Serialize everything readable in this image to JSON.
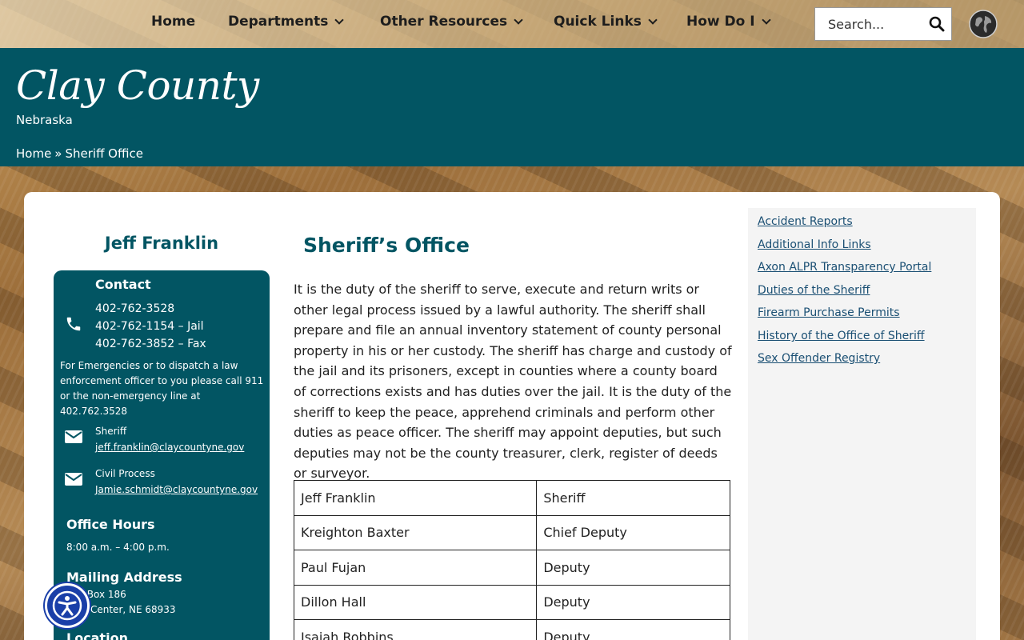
{
  "nav": {
    "items": [
      {
        "label": "Home",
        "dropdown": false
      },
      {
        "label": "Departments",
        "dropdown": true
      },
      {
        "label": "Other Resources",
        "dropdown": true
      },
      {
        "label": "Quick Links",
        "dropdown": true
      },
      {
        "label": "How Do I",
        "dropdown": true
      }
    ],
    "search_placeholder": "Search..."
  },
  "header": {
    "title": "Clay County",
    "subtitle": "Nebraska",
    "breadcrumb": {
      "home": "Home",
      "separator": "»",
      "current": "Sheriff Office"
    }
  },
  "contact": {
    "person_name": "Jeff Franklin",
    "heading": "Contact",
    "phones": [
      "402-762-3528",
      "402-762-1154 – Jail",
      "402-762-3852 – Fax"
    ],
    "emergency_note": "For Emergencies or to dispatch a law enforcement officer to you please call 911 or the non-emergency line at 402.762.3528",
    "emails": [
      {
        "label": "Sheriff",
        "address": "jeff.franklin@claycountyne.gov"
      },
      {
        "label": "Civil Process",
        "address": "Jamie.schmidt@claycountyne.gov"
      }
    ],
    "office_hours_heading": "Office Hours",
    "office_hours": "8:00 a.m. – 4:00 p.m.",
    "mailing_heading": "Mailing Address",
    "mailing_line1": "P.O. Box 186",
    "mailing_line2": "Clay Center, NE 68933",
    "location_heading": "Location"
  },
  "main": {
    "title": "Sheriff’s Office",
    "body": "It is the duty of the sheriff to serve, execute and return writs or other legal process issued by a lawful authority. The sheriff shall prepare and file an annual inventory statement of county personal property in his or her custody. The sheriff has charge and custody of the jail and its prisoners, except in counties where a county board of corrections exists and has duties over the jail. It is the duty of the sheriff to keep the peace, apprehend criminals and perform other duties as peace officer. The sheriff may appoint deputies, but such deputies may not be the county treasurer, clerk, register of deeds or surveyor.",
    "staff": [
      {
        "name": "Jeff Franklin",
        "role": "Sheriff"
      },
      {
        "name": "Kreighton Baxter",
        "role": "Chief Deputy"
      },
      {
        "name": "Paul Fujan",
        "role": "Deputy"
      },
      {
        "name": "Dillon Hall",
        "role": "Deputy"
      },
      {
        "name": "Isaiah Robbins",
        "role": "Deputy"
      }
    ]
  },
  "sidebar": {
    "links": [
      "Accident Reports",
      "Additional Info Links",
      "Axon ALPR Transparency Portal",
      "Duties of the Sheriff",
      "Firearm Purchase Permits",
      "History of the Office of Sheriff",
      "Sex Offender Registry"
    ]
  },
  "colors": {
    "brand": "#025563",
    "link": "#1a4f73",
    "accessibility": "#1a3fa8"
  },
  "icons": [
    "chevron-down-icon",
    "search-icon",
    "globe-icon",
    "phone-icon",
    "mail-icon",
    "accessibility-icon"
  ]
}
